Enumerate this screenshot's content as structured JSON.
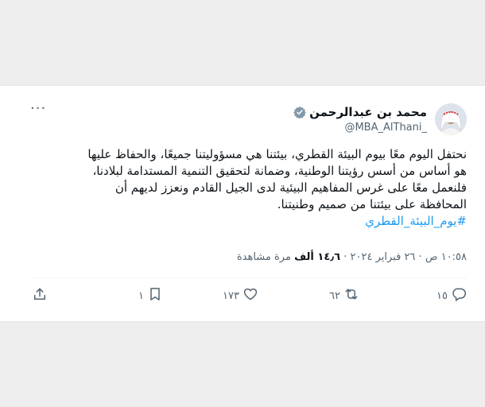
{
  "tweet": {
    "author_name": "محمد بن عبدالرحمن",
    "handle": "@MBA_AlThani_",
    "more_label": "···",
    "lines": [
      "نحتفل اليوم معًا بيوم البيئة القطري، بيئتنا هي مسؤوليتنا جميعًا، والحفاظ عليها",
      "هو أساس من أسس رؤيتنا الوطنية، وضمانة لتحقيق التنمية المستدامة لبلادنا،",
      "فلنعمل معًا على غرس المفاهيم البيئية لدى الجيل القادم ونعزز لديهم أن",
      "المحافظة على بيئتنا من صميم وطنيتنا."
    ],
    "hashtag": "#يوم_البيئة_القطري",
    "time": "١٠:٥٨ ص",
    "date": "٢٦ فبراير ٢٠٢٤",
    "views_count": "١٤٫٦ ألف",
    "views_label": "مرة مشاهدة",
    "separator": "·"
  },
  "actions": {
    "replies": "١٥",
    "retweets": "٦٢",
    "likes": "١٧٣",
    "bookmarks": "١"
  },
  "colors": {
    "accent": "#1d9bf0",
    "text": "#0f1419",
    "muted": "#536471"
  }
}
